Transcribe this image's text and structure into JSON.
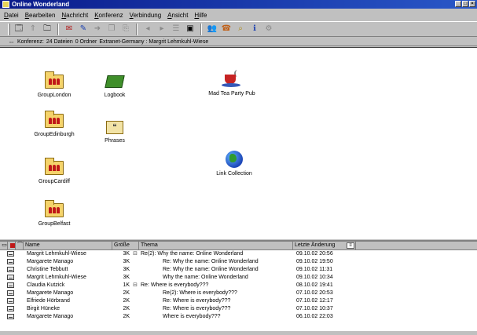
{
  "window": {
    "title": "Online Wonderland",
    "controls": [
      "_",
      "□",
      "×"
    ]
  },
  "menu": [
    "Datei",
    "Bearbeiten",
    "Nachricht",
    "Konferenz",
    "Verbindung",
    "Ansicht",
    "Hilfe"
  ],
  "status_bar": {
    "location": "Konferenz:",
    "files": "24 Dateien",
    "folders": "0 Ordner",
    "conference": "Extranet-Germany : Margrit Lehmkuhl-Wiese"
  },
  "icons": [
    {
      "label": "GroupLondon",
      "kind": "folder-people"
    },
    {
      "label": "Logbook",
      "kind": "book"
    },
    {
      "label": "Mad Tea Party Pub",
      "kind": "pub"
    },
    {
      "label": "GroupEdinburgh",
      "kind": "folder-people"
    },
    {
      "label": "Phrases",
      "kind": "phrases"
    },
    {
      "label": "Link Collection",
      "kind": "globe"
    },
    {
      "label": "GroupCardiff",
      "kind": "folder-people"
    },
    {
      "label": "GroupBelfast",
      "kind": "folder-people"
    }
  ],
  "message_list": {
    "columns": {
      "name": "Name",
      "size": "Größe",
      "subject": "Thema",
      "date": "Letzte Änderung"
    },
    "rows": [
      {
        "name": "Margrit Lehmkuhl-Wiese",
        "size": "3K",
        "expand": "⊟",
        "subject": "Re(2): Why the name: Online Wonderland",
        "date": "09.10.02 20:56"
      },
      {
        "name": "Margarete Manago",
        "size": "3K",
        "expand": "",
        "subject": "Re: Why the name: Online Wonderland",
        "date": "09.10.02 19:50"
      },
      {
        "name": "Christine Tebbutt",
        "size": "3K",
        "expand": "",
        "subject": "Re: Why the name: Online Wonderland",
        "date": "09.10.02 11:31"
      },
      {
        "name": "Margrit Lehmkuhl-Wiese",
        "size": "3K",
        "expand": "",
        "subject": "Why the name: Online Wonderland",
        "date": "09.10.02 10:34"
      },
      {
        "name": "Claudia Kutzick",
        "size": "1K",
        "expand": "⊟",
        "subject": "Re: Where is everybody???",
        "date": "08.10.02 19:41"
      },
      {
        "name": "Margarete Manago",
        "size": "2K",
        "expand": "",
        "subject": "Re(2): Where is everybody???",
        "date": "07.10.02 20:53"
      },
      {
        "name": "Elfriede Hörbrand",
        "size": "2K",
        "expand": "",
        "subject": "Re: Where is everybody???",
        "date": "07.10.02 12:17"
      },
      {
        "name": "Birgit Hüneke",
        "size": "2K",
        "expand": "",
        "subject": "Re: Where is everybody???",
        "date": "07.10.02 10:37"
      },
      {
        "name": "Margarete Manago",
        "size": "2K",
        "expand": "",
        "subject": "Where is everybody???",
        "date": "06.10.02 22:03"
      }
    ]
  }
}
